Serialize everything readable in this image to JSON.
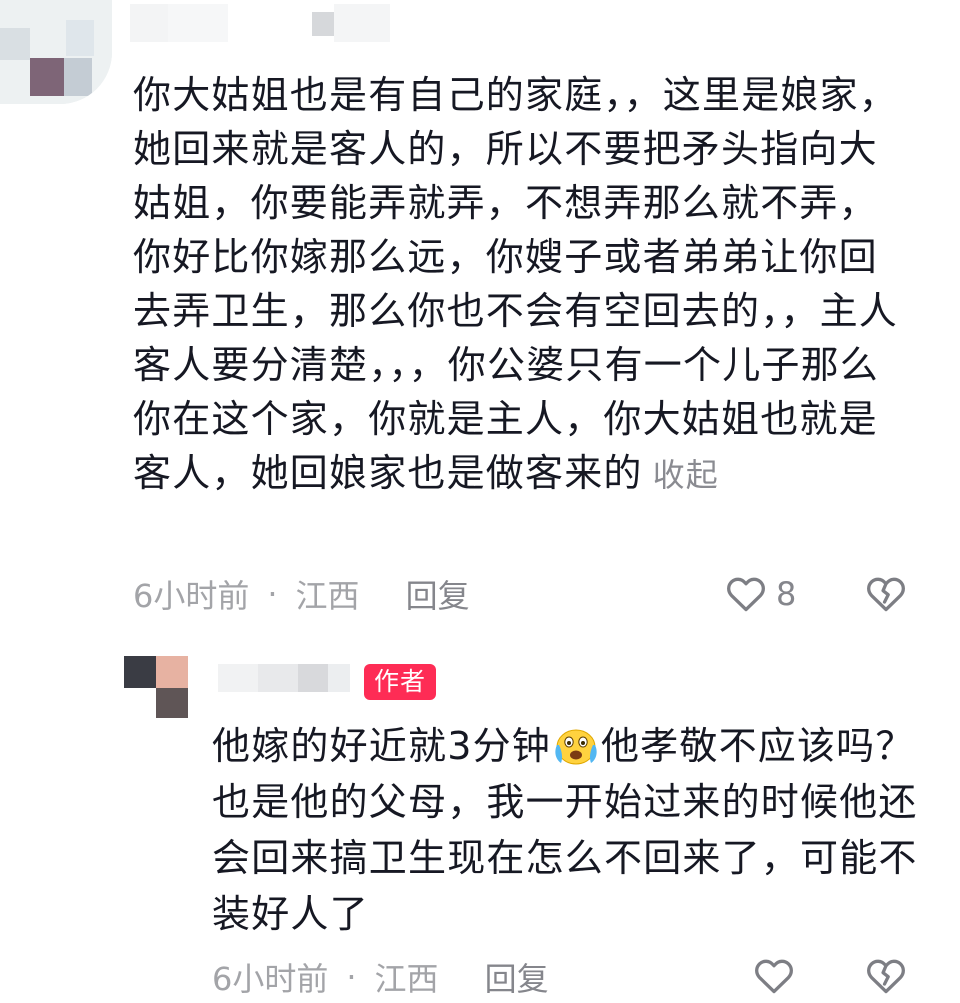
{
  "comment": {
    "text": "你大姑姐也是有自己的家庭，，这里是娘家，她回来就是客人的，所以不要把矛头指向大姑姐，你要能弄就弄，不想弄那么就不弄，你好比你嫁那么远，你嫂子或者弟弟让你回去弄卫生，那么你也不会有空回去的，，主人客人要分清楚，，，你公婆只有一个儿子那么你在这个家，你就是主人，你大姑姐也就是客人，她回娘家也是做客来的",
    "collapse_label": "收起",
    "time": "6小时前",
    "separator": "·",
    "location": "江西",
    "reply_label": "回复",
    "like_count": "8",
    "like_icon": "heart-outline-icon",
    "dislike_icon": "broken-heart-icon"
  },
  "reply": {
    "badge": "作者",
    "text_part1": "他嫁的好近就3分钟",
    "emoji": "crying-face-emoji",
    "text_part2": "他孝敬不应该吗？也是他的父母，我一开始过来的时候他还会回来搞卫生现在怎么不回来了，可能不装好人了",
    "time": "6小时前",
    "separator": "·",
    "location": "江西",
    "reply_label": "回复",
    "like_icon": "heart-outline-icon",
    "dislike_icon": "broken-heart-icon"
  },
  "colors": {
    "text": "#161823",
    "meta": "#a3a4a8",
    "badge_bg": "#fe2c55"
  }
}
